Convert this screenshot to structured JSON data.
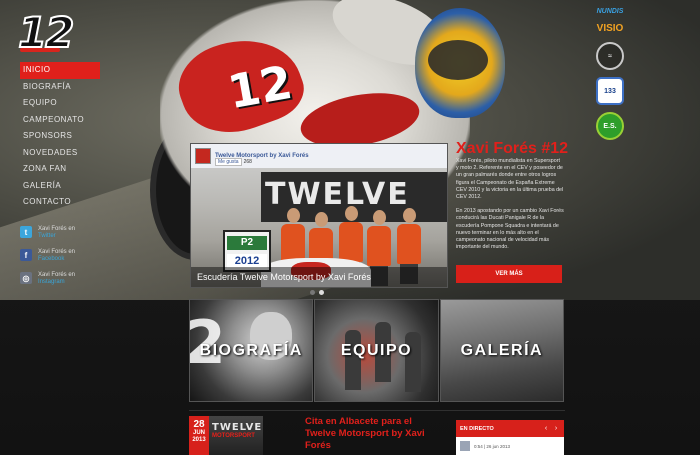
{
  "logo": {
    "text": "12"
  },
  "menu": {
    "items": [
      {
        "label": "INICIO",
        "active": true
      },
      {
        "label": "BIOGRAFÍA"
      },
      {
        "label": "EQUIPO"
      },
      {
        "label": "CAMPEONATO"
      },
      {
        "label": "SPONSORS"
      },
      {
        "label": "NOVEDADES"
      },
      {
        "label": "ZONA FAN"
      },
      {
        "label": "GALERÍA"
      },
      {
        "label": "CONTACTO"
      }
    ]
  },
  "social": [
    {
      "icon": "twitter-icon",
      "label": "Xavi Forés en",
      "network": "Twitter"
    },
    {
      "icon": "facebook-icon",
      "label": "Xavi Forés en",
      "network": "Facebook"
    },
    {
      "icon": "instagram-icon",
      "label": "Xavi Forés en",
      "network": "Instagram"
    }
  ],
  "sponsors": {
    "nundis": "NUNDIS",
    "visio": "VISIO",
    "c1": "≈",
    "c2": "133",
    "c3": "E.S."
  },
  "hero": {
    "bike_number": "12"
  },
  "slide": {
    "fb_title": "Twelve Motorsport by Xavi Forés",
    "fb_like": "Me gusta",
    "fb_like_count": "268",
    "banner_text": "TWELVE",
    "board_p": "P2",
    "board_year": "2012",
    "caption": "Escudería Twelve Motorsport by Xavi Forés"
  },
  "headline": "Xavi Forés #12",
  "bio": [
    "Xavi Forés, piloto mundialista en Supersport y moto 2. Referente en el CEV y poseedor de un gran palmarés donde entre otros logros figura el Campeonato de España Extreme CEV 2010 y la victoria en la última prueba del CEV 2012.",
    "En 2013 apostando por un cambio Xavi Forés conducirá las Ducati Panigale R de la escudería Pompone Squadra e intentará de nuevo terminar en lo más alto en el campeonato nacional de velocidad más importante del mundo."
  ],
  "vermas": "VER MÁS",
  "tiles": [
    {
      "label": "BIOGRAFÍA"
    },
    {
      "label": "EQUIPO"
    },
    {
      "label": "GALERÍA"
    }
  ],
  "news": {
    "day": "28",
    "month": "JUN",
    "year": "2013",
    "thumb_text": "TWELVE",
    "thumb_sub": "MOTORSPORT",
    "title": "Cita en Albacete para el Twelve Motorsport by Xavi Forés"
  },
  "live": {
    "title": "EN DIRECTO",
    "meta": "0:54 | 26 jun 2013"
  },
  "colors": {
    "accent": "#e0201b",
    "twitter": "#3ca6dc",
    "facebook": "#3b5998"
  }
}
